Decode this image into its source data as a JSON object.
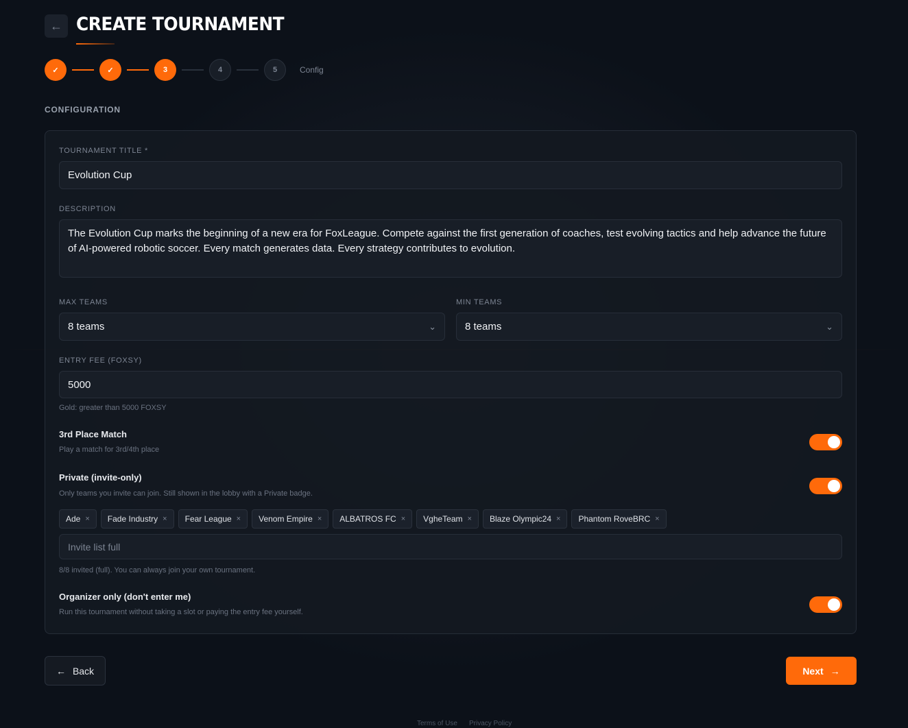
{
  "header": {
    "back_icon": "arrow-left-icon",
    "title": "CREATE TOURNAMENT"
  },
  "stepper": {
    "steps": [
      {
        "label": "✓",
        "state": "done"
      },
      {
        "label": "✓",
        "state": "done"
      },
      {
        "label": "3",
        "state": "active"
      },
      {
        "label": "4",
        "state": "pending"
      },
      {
        "label": "5",
        "state": "pending"
      }
    ],
    "current_label": "Config"
  },
  "section": {
    "title": "CONFIGURATION"
  },
  "form": {
    "title_label": "TOURNAMENT TITLE *",
    "title_value": "Evolution Cup",
    "description_label": "DESCRIPTION",
    "description_value": "The Evolution Cup marks the beginning of a new era for FoxLeague. Compete against the first generation of coaches, test evolving tactics and help advance the future of AI-powered robotic soccer. Every match generates data. Every strategy contributes to evolution.",
    "max_teams_label": "MAX TEAMS",
    "max_teams_value": "8 teams",
    "min_teams_label": "MIN TEAMS",
    "min_teams_value": "8 teams",
    "entry_fee_label": "ENTRY FEE (FOXSY)",
    "entry_fee_value": "5000",
    "entry_fee_hint": "Gold: greater than 5000 FOXSY",
    "third_place": {
      "title": "3rd Place Match",
      "hint": "Play a match for 3rd/4th place",
      "enabled": true
    },
    "private": {
      "title": "Private (invite-only)",
      "hint": "Only teams you invite can join. Still shown in the lobby with a Private badge.",
      "enabled": true
    },
    "invited_teams": [
      "Ade",
      "Fade Industry",
      "Fear League",
      "Venom Empire",
      "ALBATROS FC",
      "VgheTeam",
      "Blaze Olympic24",
      "Phantom RoveBRC"
    ],
    "invite_placeholder": "Invite list full",
    "invite_hint": "8/8 invited (full). You can always join your own tournament.",
    "organizer_only": {
      "title": "Organizer only (don't enter me)",
      "hint": "Run this tournament without taking a slot or paying the entry fee yourself.",
      "enabled": true
    }
  },
  "actions": {
    "back_label": "Back",
    "next_label": "Next"
  },
  "footer": {
    "terms": "Terms of Use",
    "privacy": "Privacy Policy"
  },
  "colors": {
    "accent": "#ff6a0a",
    "background": "#0c1119",
    "card": "#141921"
  }
}
